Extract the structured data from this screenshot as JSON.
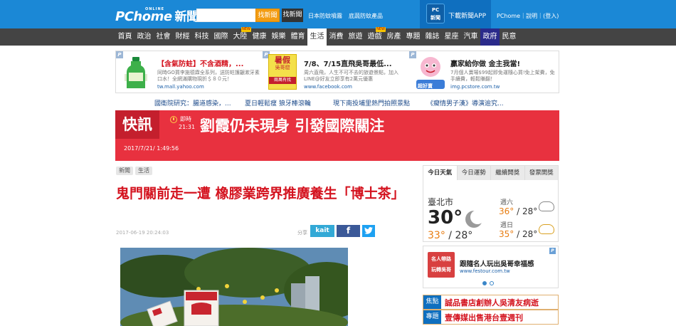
{
  "header": {
    "logo_text": "PChome",
    "logo_online": "ONLINE",
    "logo_news": "新聞",
    "search_placeholder": "",
    "search_news_button": "找新聞",
    "search_shop_button": "找新聞",
    "link_antiepidemic": "日本防蚊噴霧",
    "link_shop": "底蔬防蚊產品",
    "app_icon_line1": "PC",
    "app_icon_line2": "新聞",
    "app_label": "下載新聞APP",
    "right_links": "PChome｜說明｜(登入)"
  },
  "nav": {
    "items": [
      {
        "label": "首頁",
        "new": false
      },
      {
        "label": "政治",
        "new": false
      },
      {
        "label": "社會",
        "new": false
      },
      {
        "label": "財經",
        "new": false
      },
      {
        "label": "科技",
        "new": false
      },
      {
        "label": "國際",
        "new": false
      },
      {
        "label": "大陸",
        "new": true
      },
      {
        "label": "健康",
        "new": false
      },
      {
        "label": "娛樂",
        "new": false
      },
      {
        "label": "體育",
        "new": false
      },
      {
        "label": "生活",
        "new": false,
        "active": true
      },
      {
        "label": "消費",
        "new": false
      },
      {
        "label": "旅遊",
        "new": false
      },
      {
        "label": "遊戲",
        "new": true
      },
      {
        "label": "房產",
        "new": false
      },
      {
        "label": "專題",
        "new": false
      },
      {
        "label": "雜誌",
        "new": false
      },
      {
        "label": "星座",
        "new": false
      },
      {
        "label": "汽車",
        "new": false
      },
      {
        "label": "政府",
        "new": false,
        "highlight": true
      },
      {
        "label": "民意",
        "new": false
      }
    ],
    "new_badge": "NEW"
  },
  "ads": [
    {
      "title": "【含氣防蛀】不含酒精，...",
      "desc": "同時GO買李施德霖全系列，送防蛀護齦漱牙素口水！全網滿購物現折＄８０元！",
      "url": "tw.mall.yahoo.com",
      "title_color": "#d4131f"
    },
    {
      "title": "7/8、7/15直飛吳哥最低...",
      "desc": "周六直飛，人生不可不去的旅遊景點，加入LINE@好友立即享有2萬元優惠",
      "url": "www.facebook.com",
      "title_color": "#222222",
      "img_text1": "暑假",
      "img_text2": "吳哥窟",
      "img_text3": "兩萬有找"
    },
    {
      "title": "贏家給你做 金主我當!",
      "desc": "7月個人賣場$99起即免運隨心買!免上架費，免手續費，輕鬆賺翻！",
      "url": "img.pcstore.com.tw",
      "title_color": "#222222",
      "img_text": "超好賣"
    }
  ],
  "ad_badge": "P",
  "headlines": [
    "國衛院研究：腸道感染，...",
    "夏日輕鬆瘦 狼牙棒滾輪",
    "現下南投埔里熱門拍照景點",
    "《癡情男子漢》導演逾究..."
  ],
  "flash": {
    "label": "快訊",
    "time_line1": "即時",
    "time_line2": "21:31",
    "text": "劉霞仍未現身 引發國際關注",
    "date": "2017/7/21/ 1:49:56"
  },
  "article": {
    "breadcrumbs": [
      "新聞",
      "生活"
    ],
    "title": "鬼門關前走一遭 橡膠業跨界推廣養生「博士茶」",
    "date": "2017-06-19 20:24:03",
    "share_label": "分享",
    "share_kait": "kait",
    "share_fb": "f",
    "share_tw": "t"
  },
  "weather": {
    "tabs": [
      "今日天氣",
      "今日運勢",
      "繼續開獎",
      "發票開獎"
    ],
    "city": "臺北市",
    "now_temp": "30°",
    "today_high": "33°",
    "today_sep": " / ",
    "today_low": "28°",
    "forecast": [
      {
        "day": "週六",
        "high": "36°",
        "low": "28°"
      },
      {
        "day": "週日",
        "high": "35°",
        "low": "28°"
      }
    ]
  },
  "side_ad": {
    "thumb_line1": "名人帶路",
    "thumb_line2": "玩轉吳哥",
    "title": "跟隨名人玩出吳哥幸福感",
    "url": "www.festour.com.tw",
    "badge": "P"
  },
  "side_rows": [
    {
      "tag": "焦點",
      "text": "誠品書店創辦人吳清友病逝"
    },
    {
      "tag": "專題",
      "text": "壹傳媒出售港台壹週刊"
    }
  ]
}
